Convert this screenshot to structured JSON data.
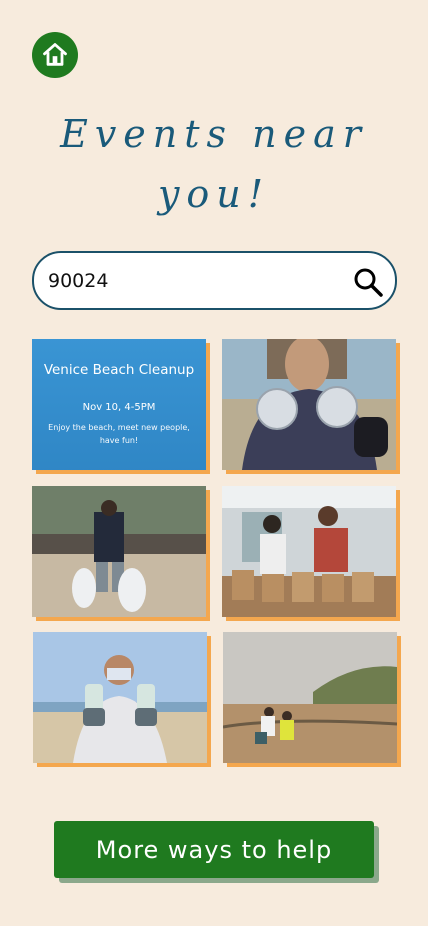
{
  "header": {
    "home_icon": "home-icon"
  },
  "page": {
    "title": "Events near you!"
  },
  "search": {
    "value": "90024",
    "icon": "search-icon"
  },
  "events": {
    "featured": {
      "title": "Venice Beach Cleanup",
      "date": "Nov 10, 4-5PM",
      "description": "Enjoy the beach, meet new people, have fun!"
    }
  },
  "footer": {
    "more_label": "More ways to help"
  },
  "colors": {
    "background": "#f7ebdd",
    "primary_green": "#1f7a1f",
    "accent_orange": "#f4a74e",
    "title_blue": "#1a5a7a",
    "card_blue": "#3690cf"
  }
}
